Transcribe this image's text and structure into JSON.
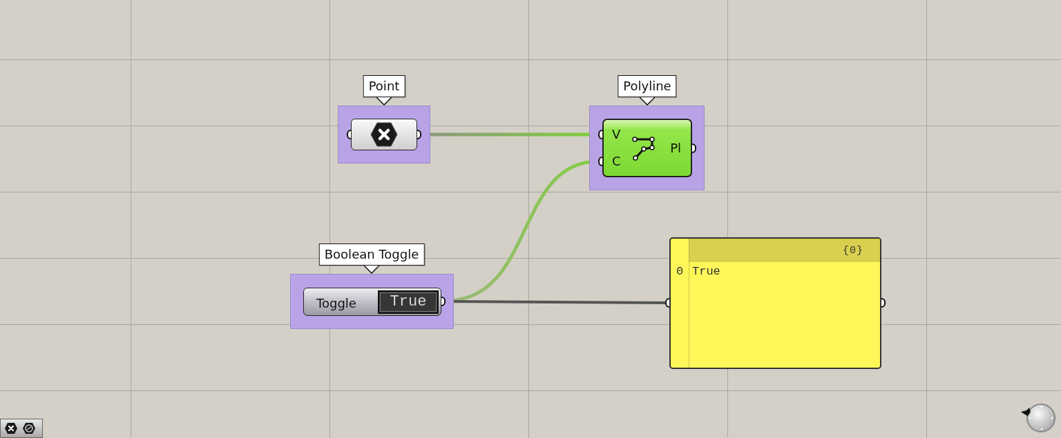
{
  "nodes": [
    {
      "kind": "param",
      "tag": "Point"
    },
    {
      "kind": "component",
      "tag": "Polyline",
      "inputs": [
        "V",
        "C"
      ],
      "outputs": [
        "Pl"
      ]
    },
    {
      "kind": "toggle",
      "tag": "Boolean Toggle",
      "label": "Toggle",
      "value": "True"
    },
    {
      "kind": "panel",
      "header": "{0}",
      "rows": [
        {
          "index": "0",
          "value": "True"
        }
      ]
    }
  ]
}
